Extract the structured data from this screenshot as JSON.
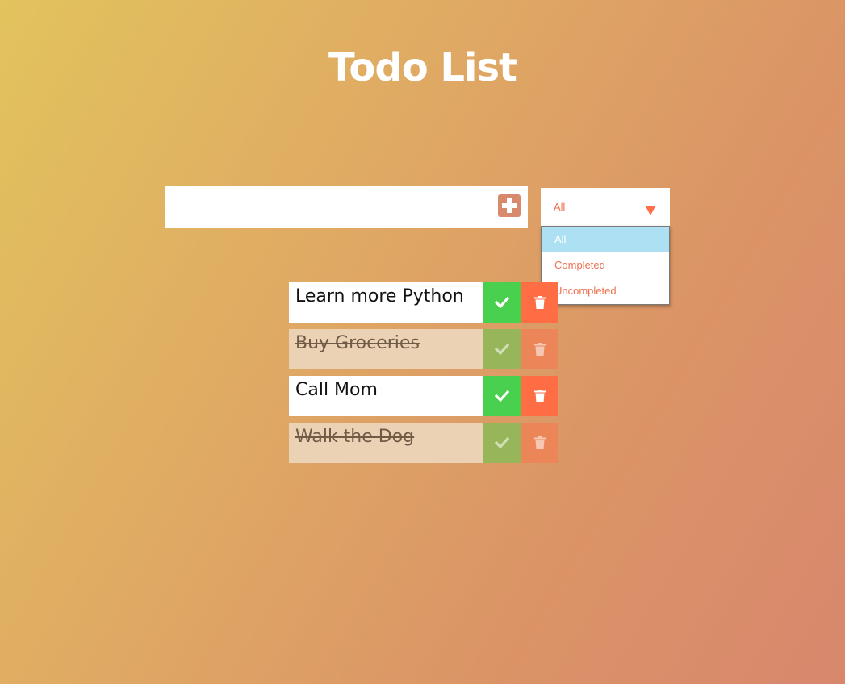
{
  "header": {
    "title": "Todo List"
  },
  "new_todo": {
    "value": "",
    "placeholder": "",
    "add_icon": "plus-square-icon"
  },
  "filter": {
    "selected": "All",
    "options": [
      "All",
      "Completed",
      "Uncompleted"
    ],
    "highlighted": "All"
  },
  "todos": [
    {
      "text": "Learn more Python",
      "completed": false
    },
    {
      "text": "Buy Groceries",
      "completed": true
    },
    {
      "text": "Call Mom",
      "completed": false
    },
    {
      "text": "Walk the Dog",
      "completed": true
    }
  ],
  "icons": {
    "complete": "check-icon",
    "delete": "trash-icon"
  },
  "colors": {
    "accent": "#ff6f47",
    "complete_green": "#49d04e",
    "delete_orange": "#ff6d45",
    "dropdown_highlight": "#aee0f4"
  }
}
